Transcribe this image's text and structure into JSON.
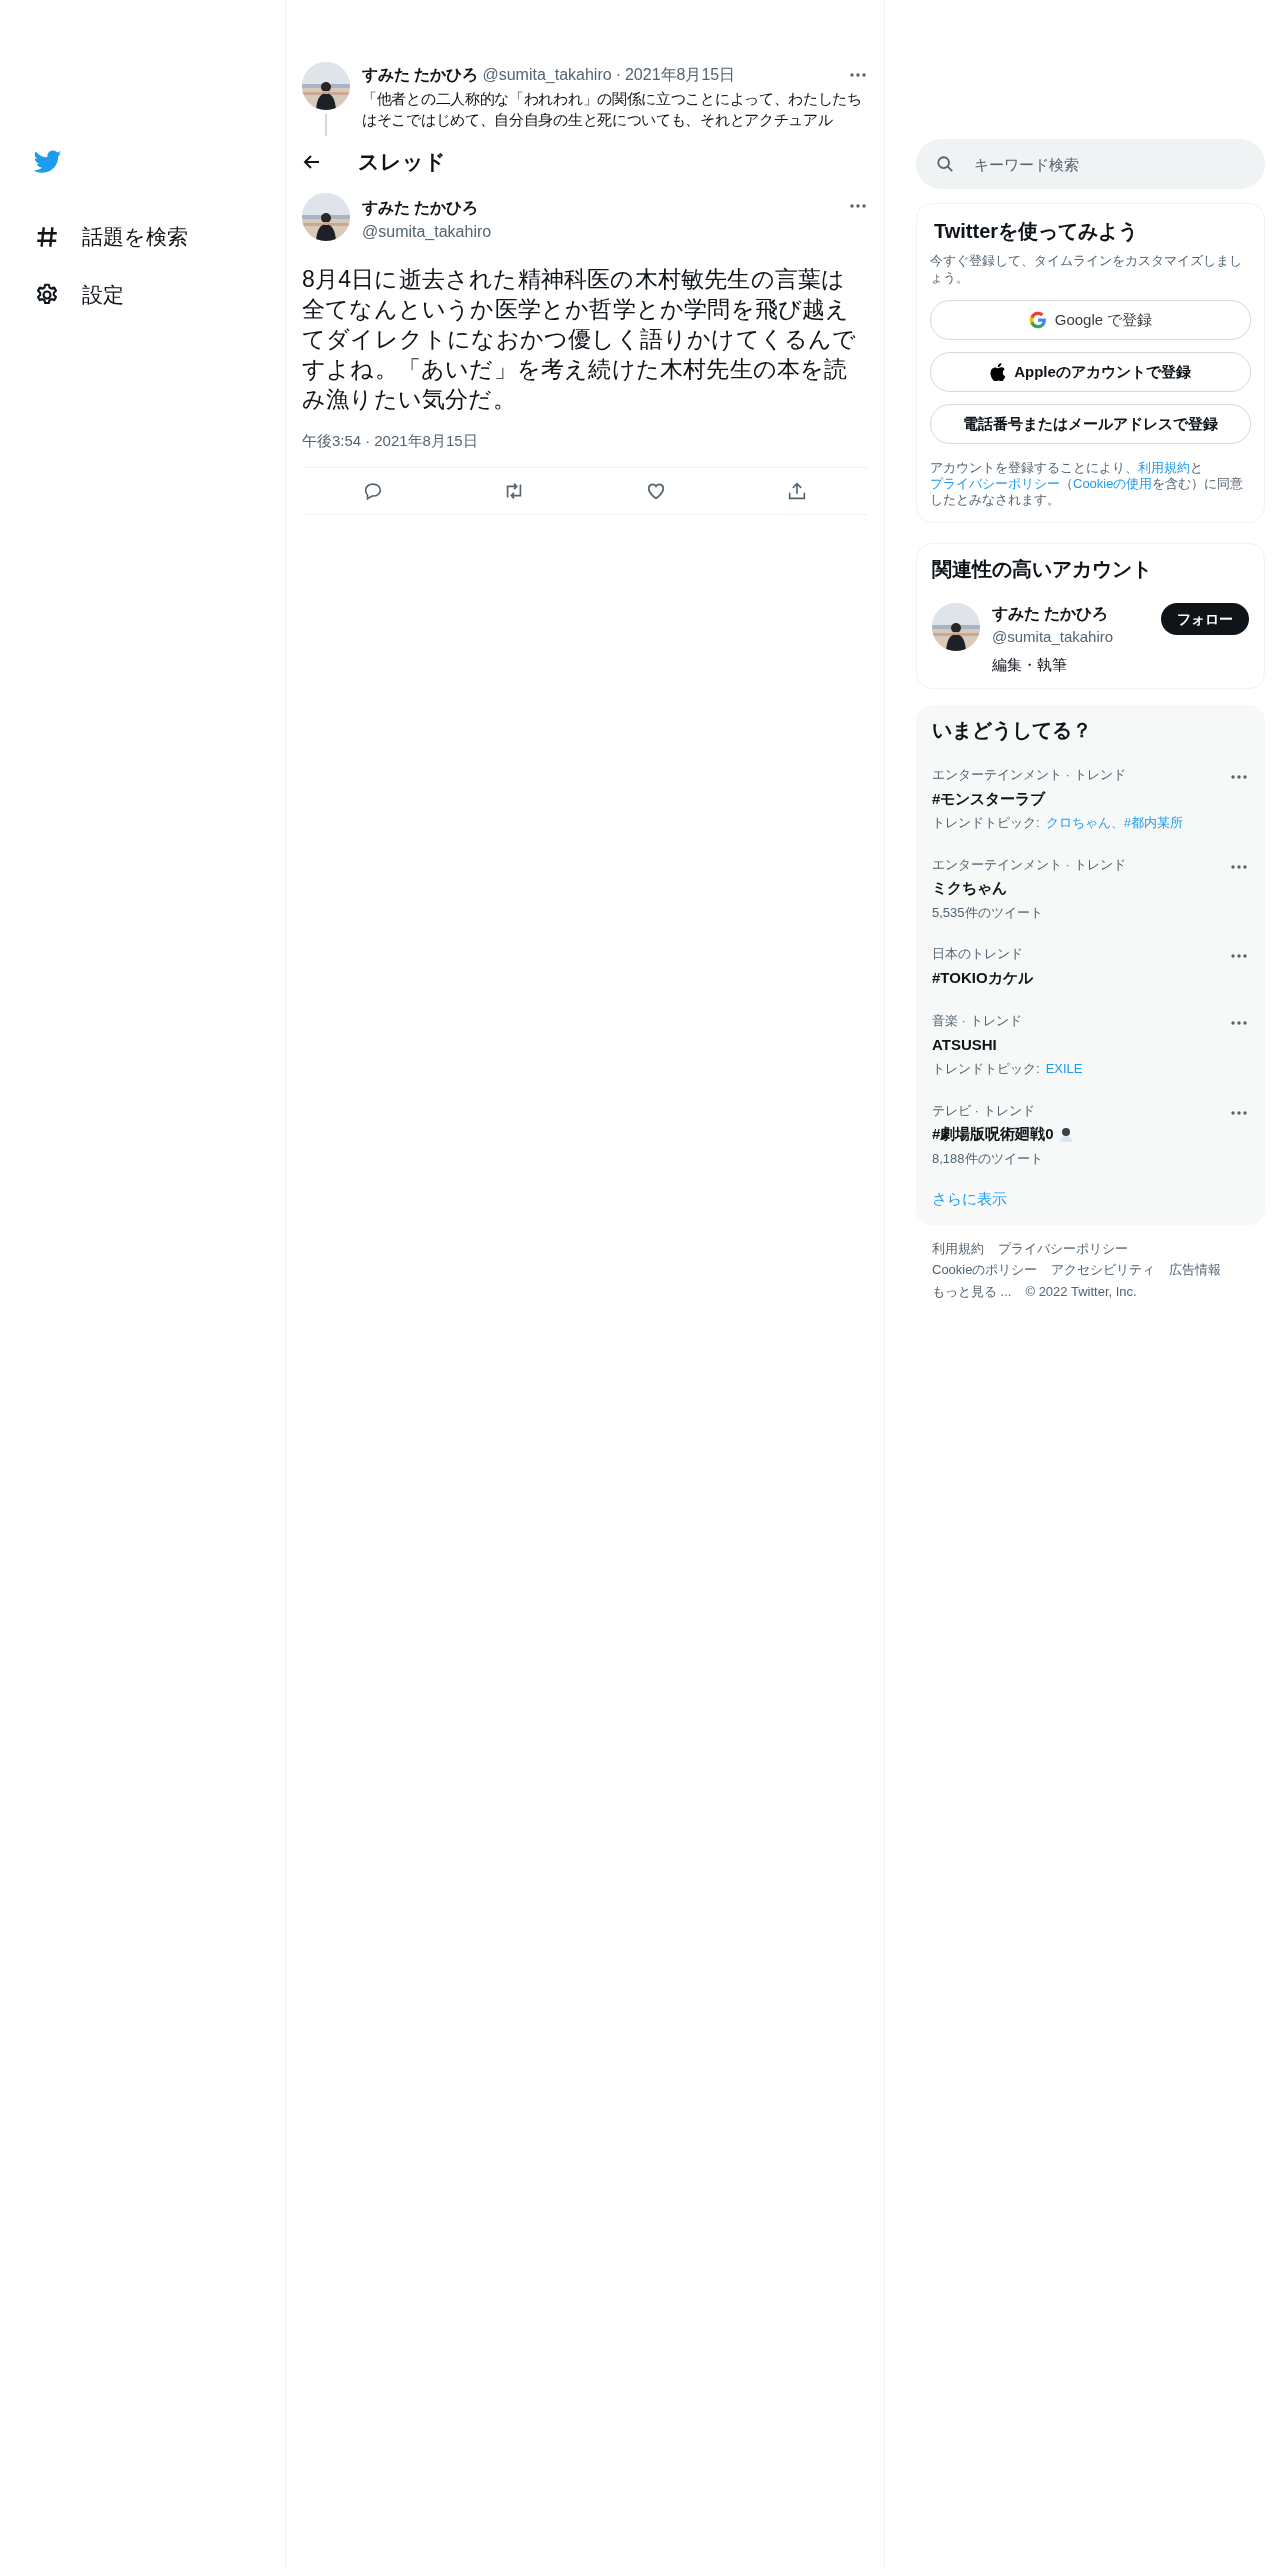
{
  "sidebar": {
    "items": [
      {
        "kind": "explore",
        "label": "話題を検索"
      },
      {
        "kind": "settings",
        "label": "設定"
      }
    ]
  },
  "parent_tweet": {
    "name": "すみた たかひろ",
    "handle": "@sumita_takahiro",
    "separator": "·",
    "date": "2021年8月15日",
    "text": "「他者との二人称的な「われわれ」の関係に立つことによって、わたしたちはそこではじめて、自分自身の生と死についても、それとアクチュアル"
  },
  "header": {
    "title": "スレッド"
  },
  "tweet": {
    "name": "すみた たかひろ",
    "handle": "@sumita_takahiro",
    "text": "8月4日に逝去された精神科医の木村敏先生の言葉は全てなんというか医学とか哲学とか学問を飛び越えてダイレクトになおかつ優しく語りかけてくるんですよね。「あいだ」を考え続けた木村先生の本を読み漁りたい気分だ。",
    "time": "午後3:54",
    "separator": "·",
    "date": "2021年8月15日"
  },
  "search": {
    "placeholder": "キーワード検索"
  },
  "signup": {
    "title": "Twitterを使ってみよう",
    "subtitle": "今すぐ登録して、タイムラインをカスタマイズしましょう。",
    "buttons": [
      {
        "kind": "google",
        "label": "Google で登録"
      },
      {
        "kind": "apple",
        "label": "Appleのアカウントで登録"
      },
      {
        "kind": "plain",
        "label": "電話番号またはメールアドレスで登録"
      }
    ],
    "legal": [
      {
        "text": "アカウントを登録することにより、",
        "link": false
      },
      {
        "text": "利用規約",
        "link": true
      },
      {
        "text": "と",
        "link": false
      },
      {
        "text": "プライバシーポリシー",
        "link": true
      },
      {
        "text": "（",
        "link": false
      },
      {
        "text": "Cookieの使用",
        "link": true
      },
      {
        "text": "を含む）に同意したとみなされます。",
        "link": false
      }
    ]
  },
  "related": {
    "title": "関連性の高いアカウント",
    "accounts": [
      {
        "name": "すみた たかひろ",
        "handle": "@sumita_takahiro",
        "bio": "編集・執筆",
        "button": "フォロー"
      }
    ]
  },
  "trends": {
    "title": "いまどうしてる？",
    "items": [
      {
        "category": "エンターテインメント · トレンド",
        "title": "#モンスターラブ",
        "kind": "topics",
        "meta_label": "トレンドトピック:",
        "meta": "クロちゃん、#都内某所"
      },
      {
        "category": "エンターテインメント · トレンド",
        "title": "ミクちゃん",
        "kind": "count",
        "meta": "5,535件のツイート"
      },
      {
        "category": "日本のトレンド",
        "title": "#TOKIOカケル",
        "kind": "none"
      },
      {
        "category": "音楽 · トレンド",
        "title": "ATSUSHI",
        "kind": "topics",
        "meta_label": "トレンドトピック:",
        "meta": "EXILE"
      },
      {
        "category": "テレビ · トレンド",
        "title": "#劇場版呪術廻戦0",
        "kind": "count",
        "meta": "8,188件のツイート",
        "hashflag": true
      }
    ],
    "more": "さらに表示"
  },
  "footer": {
    "lines": [
      [
        "利用規約",
        "プライバシーポリシー"
      ],
      [
        "Cookieのポリシー",
        "アクセシビリティ",
        "広告情報"
      ],
      [
        "もっと見る ...",
        "© 2022 Twitter, Inc."
      ]
    ]
  }
}
